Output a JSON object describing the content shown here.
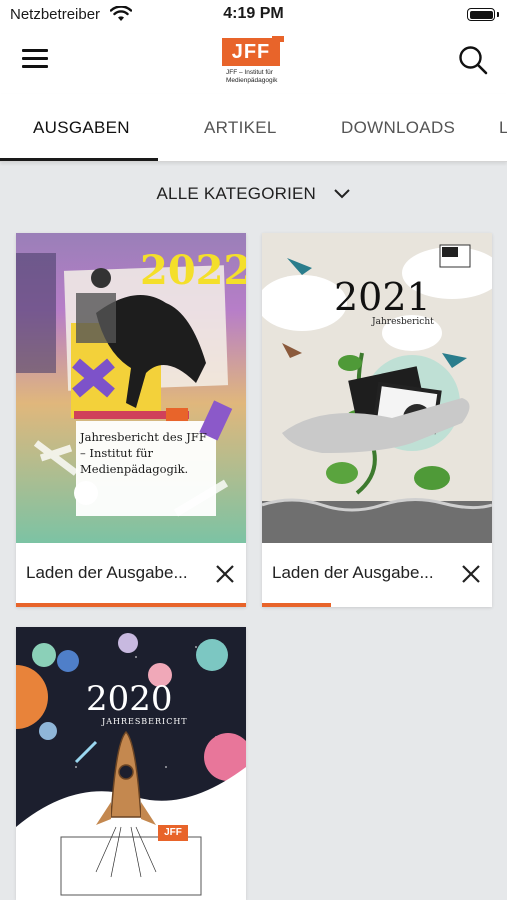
{
  "status_bar": {
    "carrier": "Netzbetreiber",
    "time": "4:19 PM"
  },
  "app_bar": {
    "logo_mark": "JFF",
    "logo_subtitle": "JFF – Institut für\nMedienpädagogik",
    "menu_icon": "hamburger-menu-icon",
    "search_icon": "search-icon"
  },
  "tabs": [
    {
      "label": "AUSGABEN",
      "active": true
    },
    {
      "label": "ARTIKEL",
      "active": false
    },
    {
      "label": "DOWNLOADS",
      "active": false
    },
    {
      "label": "L",
      "active": false
    }
  ],
  "filter": {
    "label": "ALLE KATEGORIEN",
    "icon": "chevron-down-icon"
  },
  "issues": [
    {
      "year": "2022",
      "cover_text": "Jahresbericht des JFF – Institut für Medienpädagogik.",
      "footer_label": "Laden der Ausgabe...",
      "progress": 1.0,
      "accent": "#e8642a"
    },
    {
      "year": "2021",
      "cover_subtitle": "Jahresbericht",
      "footer_label": "Laden der Ausgabe...",
      "progress": 0.3,
      "accent": "#e8642a"
    },
    {
      "year": "2020",
      "cover_subtitle": "JAHRESBERICHT",
      "logo_mark": "JFF"
    }
  ],
  "colors": {
    "accent": "#e8642a",
    "background": "#e6e8ea"
  }
}
